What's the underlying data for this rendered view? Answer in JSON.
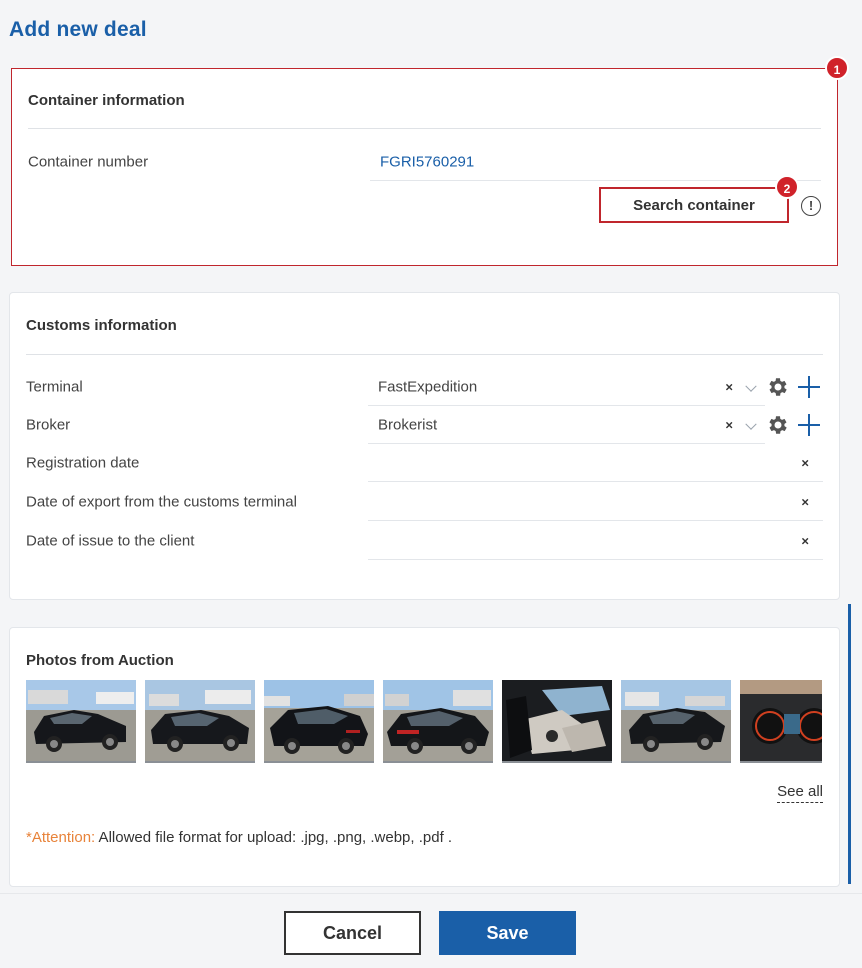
{
  "page": {
    "title": "Add new deal"
  },
  "container_section": {
    "title": "Container information",
    "badge": "1",
    "container_number_label": "Container number",
    "container_number_value": "FGRI5760291",
    "search_button_label": "Search container",
    "search_badge": "2",
    "info_icon_glyph": "!"
  },
  "customs_section": {
    "title": "Customs information",
    "terminal": {
      "label": "Terminal",
      "value": "FastExpedition"
    },
    "broker": {
      "label": "Broker",
      "value": "Brokerist"
    },
    "registration_date": {
      "label": "Registration date",
      "value": ""
    },
    "export_date": {
      "label": "Date of export from the customs terminal",
      "value": ""
    },
    "issue_date": {
      "label": "Date of issue to the client",
      "value": ""
    },
    "clear_glyph": "×"
  },
  "photos_section": {
    "title": "Photos from Auction",
    "see_all_label": "See all",
    "attention_prefix": "*Attention:",
    "attention_text": " Allowed file format for upload: .jpg, .png, .webp, .pdf ."
  },
  "footer": {
    "cancel_label": "Cancel",
    "save_label": "Save"
  },
  "colors": {
    "accent": "#1a5fa8",
    "highlight": "#c0262d",
    "badge": "#d0222a",
    "warning": "#e8833a"
  },
  "icons": [
    "info-icon",
    "gear-icon",
    "plus-icon",
    "chevron-down-icon",
    "clear-icon"
  ]
}
